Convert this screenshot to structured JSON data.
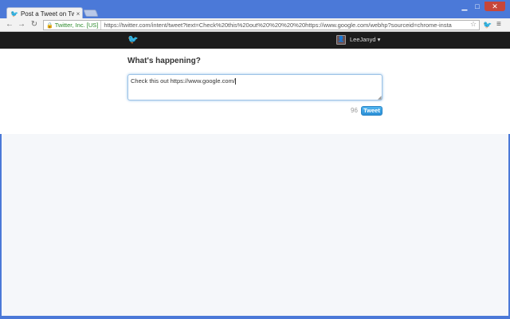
{
  "browser": {
    "tab": {
      "title": "Post a Tweet on Twi",
      "favicon": "twitter-bird-icon",
      "close": "×"
    },
    "window_controls": {
      "minimize": "▁",
      "maximize": "□",
      "close": "✕"
    },
    "nav": {
      "back": "←",
      "forward": "→",
      "reload": "↻"
    },
    "address": {
      "ev_label": "Twitter, Inc. [US]",
      "url": "https://twitter.com/intent/tweet?text=Check%20this%20out%20%20%20%20https://www.google.com/webhp?sourceid=chrome-insta"
    },
    "star": "☆",
    "menu": "≡"
  },
  "twitter": {
    "user": {
      "name": "LeeJanyd ▾",
      "avatar_icon": "avatar-icon"
    },
    "heading": "What's happening?",
    "compose_text": "Check this out    https://www.google.com/",
    "char_count": "96",
    "tweet_label": "Tweet"
  },
  "colors": {
    "chrome_frame": "#4b79d8",
    "twitter_bar": "#1c1c1c",
    "twitter_blue": "#2aa3ef"
  }
}
